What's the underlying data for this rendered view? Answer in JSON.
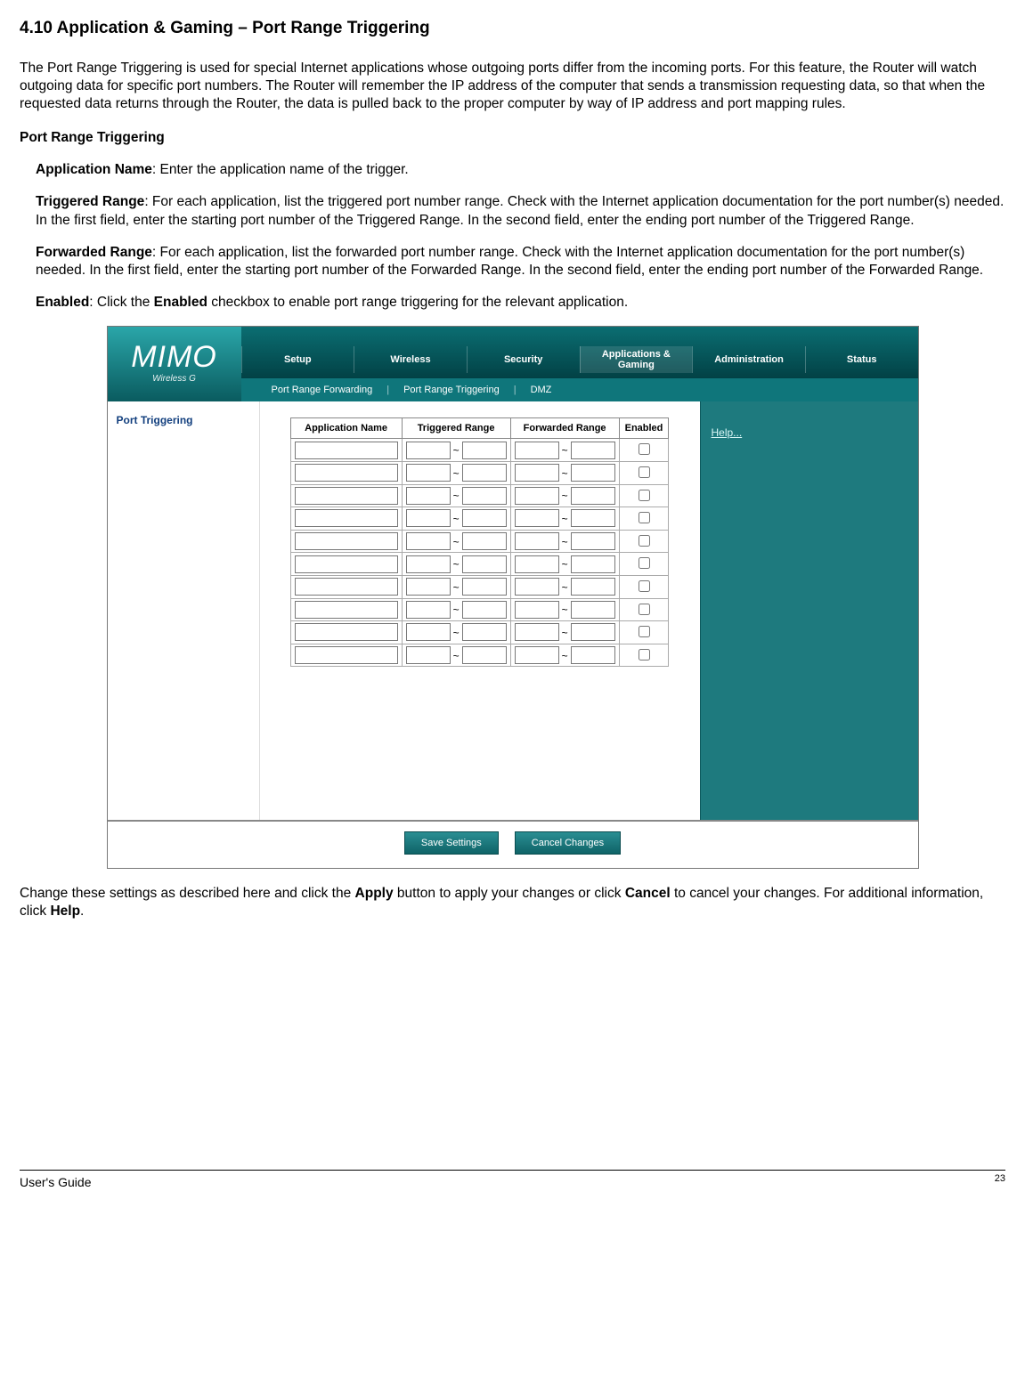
{
  "heading": "4.10 Application & Gaming – Port Range Triggering",
  "intro": "The Port Range Triggering is used for special Internet applications whose outgoing ports differ from the incoming ports. For this feature, the Router will watch outgoing data for specific port numbers. The Router will remember the IP address of the computer that sends a transmission requesting data, so that when the requested data returns through the Router, the data is pulled back to the proper computer by way of IP address and port mapping rules.",
  "subheading": "Port Range Triggering",
  "fields": {
    "app_name_label": "Application Name",
    "app_name_text": ": Enter the application name of the trigger.",
    "trig_label": "Triggered Range",
    "trig_text": ": For each application, list the triggered port number range. Check with the Internet application documentation for the port number(s) needed. In the first field, enter the starting port number of the Triggered Range. In the second field, enter the ending port number of the Triggered Range.",
    "fwd_label": "Forwarded Range",
    "fwd_text": ": For each application, list the forwarded port number range. Check with the Internet application documentation for the port number(s) needed. In the first field, enter the starting port number of the Forwarded Range. In the second field, enter the ending port number of the Forwarded Range.",
    "en_label": "Enabled",
    "en_text_pre": ": Click the ",
    "en_text_bold": "Enabled",
    "en_text_post": " checkbox to enable port range triggering for the relevant application."
  },
  "closing": {
    "pre": "Change these settings as described here and click the ",
    "b1": "Apply",
    "mid1": " button to apply your changes or click ",
    "b2": "Cancel",
    "mid2": " to cancel your changes. For additional information, click ",
    "b3": "Help",
    "post": "."
  },
  "router": {
    "logo": "MIMO",
    "logo_sub": "Wireless G",
    "tabs": [
      "Setup",
      "Wireless",
      "Security",
      "Applications & Gaming",
      "Administration",
      "Status"
    ],
    "active_tab_index": 3,
    "subnav": [
      "Port Range Forwarding",
      "Port Range Triggering",
      "DMZ"
    ],
    "panel_title": "Port Triggering",
    "help_link": "Help...",
    "table_headers": [
      "Application Name",
      "Triggered Range",
      "Forwarded Range",
      "Enabled"
    ],
    "row_count": 10,
    "range_separator": "~",
    "buttons": {
      "save": "Save Settings",
      "cancel": "Cancel Changes"
    }
  },
  "footer": {
    "guide": "User's Guide",
    "page": "23"
  }
}
